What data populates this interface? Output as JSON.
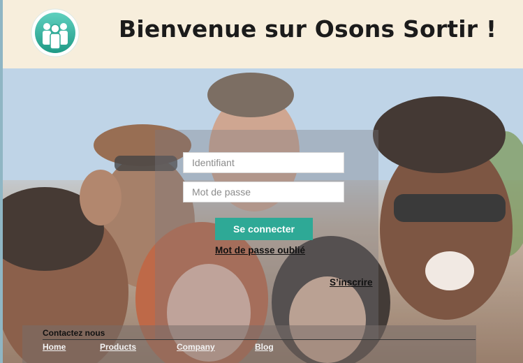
{
  "header": {
    "title": "Bienvenue sur Osons Sortir !",
    "logo_icon": "group-of-people-icon"
  },
  "login": {
    "username_placeholder": "Identifiant",
    "password_placeholder": "Mot de passe",
    "submit_label": "Se connecter",
    "forgot_label": "Mot de passe oublié",
    "signup_label": "S’inscrire"
  },
  "footer": {
    "title": "Contactez nous",
    "links": [
      "Home",
      "Products",
      "Company",
      "Blog"
    ]
  },
  "colors": {
    "accent": "#2ea996",
    "header_bg": "#f7eedc"
  }
}
